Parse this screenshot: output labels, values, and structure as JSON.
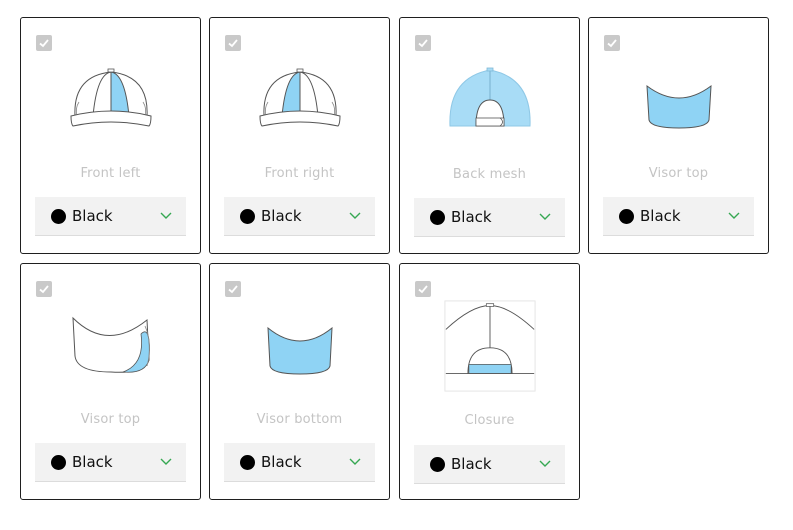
{
  "accent": "#8fd3f4",
  "panels": [
    {
      "label": "Front left",
      "color_name": "Black",
      "color_hex": "#000000",
      "icon": "cap-front-left-icon"
    },
    {
      "label": "Front right",
      "color_name": "Black",
      "color_hex": "#000000",
      "icon": "cap-front-right-icon"
    },
    {
      "label": "Back mesh",
      "color_name": "Black",
      "color_hex": "#000000",
      "icon": "cap-back-mesh-icon"
    },
    {
      "label": "Visor top",
      "color_name": "Black",
      "color_hex": "#000000",
      "icon": "visor-top-icon"
    },
    {
      "label": "Visor top",
      "color_name": "Black",
      "color_hex": "#000000",
      "icon": "visor-top-side-icon"
    },
    {
      "label": "Visor bottom",
      "color_name": "Black",
      "color_hex": "#000000",
      "icon": "visor-bottom-icon"
    },
    {
      "label": "Closure",
      "color_name": "Black",
      "color_hex": "#000000",
      "icon": "cap-closure-icon"
    }
  ]
}
